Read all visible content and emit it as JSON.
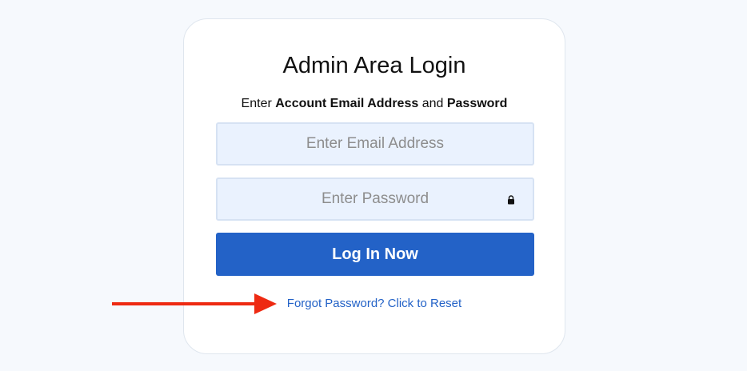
{
  "login": {
    "title": "Admin Area Login",
    "subtitle_prefix": "Enter ",
    "subtitle_email_bold": "Account Email Address",
    "subtitle_middle": " and ",
    "subtitle_password_bold": "Password",
    "email_placeholder": "Enter Email Address",
    "password_placeholder": "Enter Password",
    "submit_label": "Log In Now",
    "reset_link_label": "Forgot Password? Click to Reset"
  },
  "icons": {
    "password_field_icon": "lock-icon",
    "annotation": "red-arrow-icon"
  },
  "colors": {
    "page_background": "#f6f9fd",
    "card_background": "#ffffff",
    "input_background": "#eaf2fe",
    "primary_button": "#2362c7",
    "link": "#2362c7",
    "arrow": "#ee2a12"
  }
}
